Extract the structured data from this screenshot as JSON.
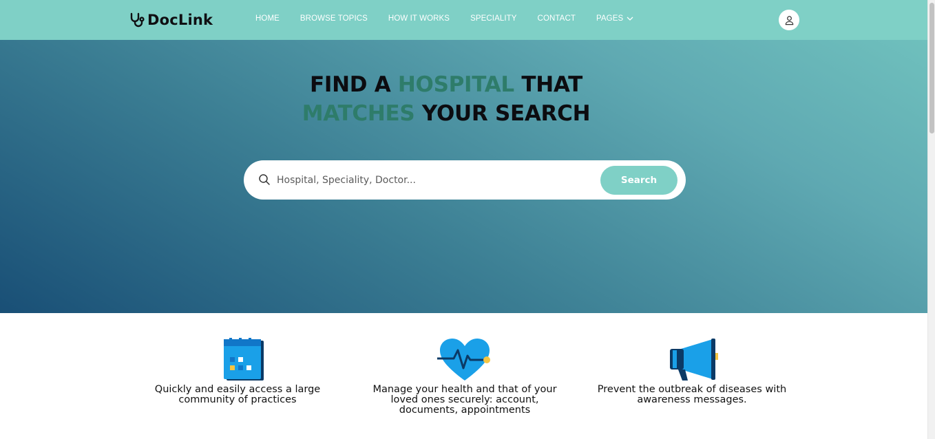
{
  "brand": {
    "name": "DocLink"
  },
  "nav": {
    "items": [
      {
        "label": "HOME"
      },
      {
        "label": "BROWSE TOPICS"
      },
      {
        "label": "HOW IT WORKS"
      },
      {
        "label": "SPECIALITY"
      },
      {
        "label": "CONTACT"
      },
      {
        "label": "PAGES"
      }
    ]
  },
  "hero": {
    "line1": {
      "a": "FIND A ",
      "highlight": "HOSPITAL",
      "b": " THAT"
    },
    "line2": {
      "highlight": "MATCHES",
      "b": " YOUR SEARCH"
    },
    "search": {
      "placeholder": "Hospital, Speciality, Doctor...",
      "button_label": "Search"
    }
  },
  "features": [
    {
      "icon": "calendar-icon",
      "text": "Quickly and easily access a large community of practices"
    },
    {
      "icon": "heart-rate-icon",
      "text": "Manage your health and that of your loved ones securely: account, documents, appointments"
    },
    {
      "icon": "megaphone-icon",
      "text": "Prevent the outbreak of diseases with awareness messages."
    }
  ],
  "colors": {
    "navbar": "#7fd0c6",
    "accent": "#7fd0c6",
    "highlight_text": "#2e7c6a",
    "hero_gradient_start": "#194f76",
    "hero_gradient_end": "#6fc0bd"
  }
}
